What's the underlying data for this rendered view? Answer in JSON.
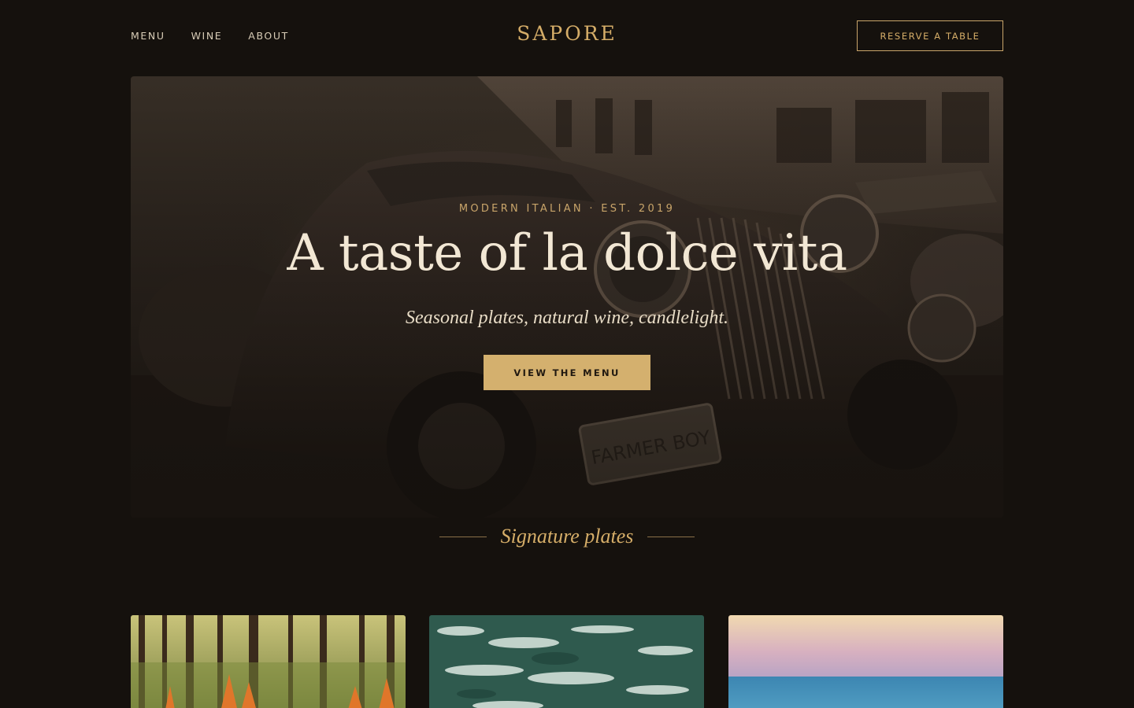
{
  "header": {
    "nav": [
      {
        "label": "MENU"
      },
      {
        "label": "WINE"
      },
      {
        "label": "ABOUT"
      }
    ],
    "logo": "SAPORE",
    "reserve_label": "RESERVE A TABLE"
  },
  "hero": {
    "eyebrow": "MODERN ITALIAN · EST. 2019",
    "title": "A taste of la dolce vita",
    "subtitle": "Seasonal plates, natural wine, candlelight.",
    "cta_label": "VIEW THE MENU",
    "image_plate_text": "FARMER BOY"
  },
  "signature": {
    "title": "Signature plates"
  },
  "colors": {
    "background": "#15110d",
    "accent": "#d4b06e",
    "text": "#f2e7d4"
  }
}
